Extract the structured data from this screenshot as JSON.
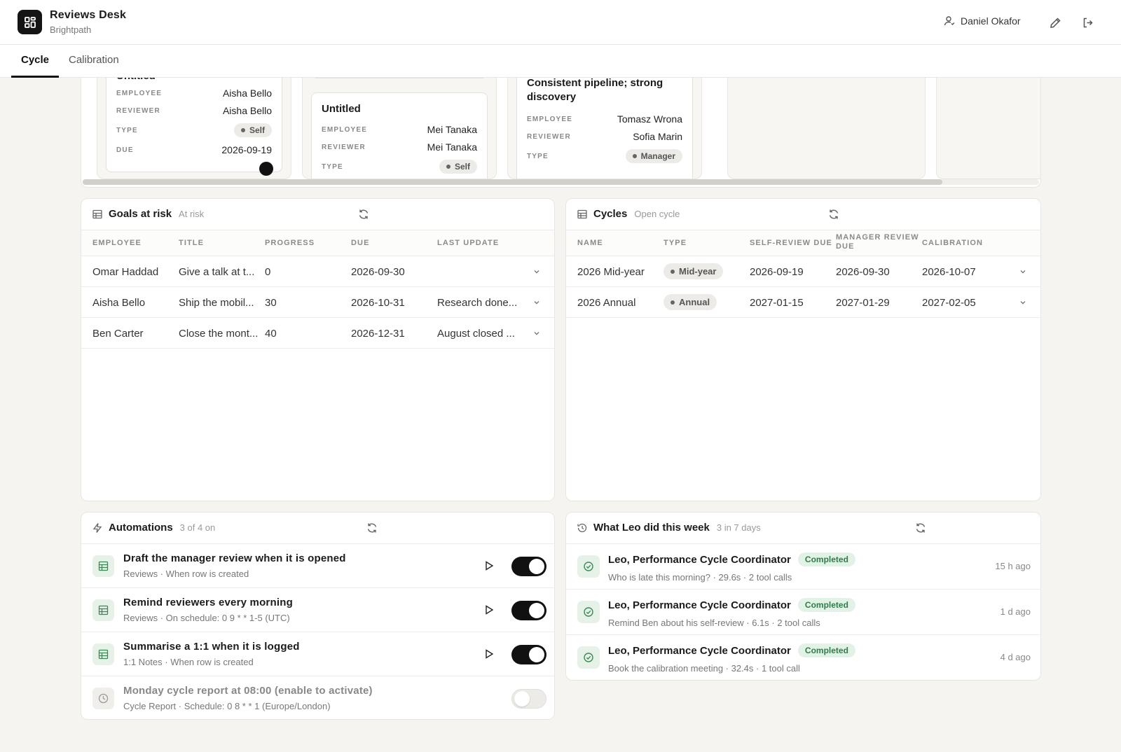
{
  "app": {
    "title": "Reviews Desk",
    "org": "Brightpath",
    "user": "Daniel Okafor"
  },
  "tabs": [
    {
      "label": "Cycle",
      "active": true
    },
    {
      "label": "Calibration",
      "active": false
    }
  ],
  "kanban": {
    "cards": [
      {
        "title": "Untitled",
        "rows": [
          {
            "label": "EMPLOYEE",
            "value": "Aisha Bello"
          },
          {
            "label": "REVIEWER",
            "value": "Aisha Bello"
          },
          {
            "label": "TYPE",
            "value": "Self"
          },
          {
            "label": "DUE",
            "value": "2026-09-19"
          }
        ]
      },
      {
        "title": "Untitled",
        "rows": [
          {
            "label": "EMPLOYEE",
            "value": "Mei Tanaka"
          },
          {
            "label": "REVIEWER",
            "value": "Mei Tanaka"
          },
          {
            "label": "TYPE",
            "value": "Self"
          }
        ]
      },
      {
        "title": "Consistent pipeline; strong discovery",
        "rows": [
          {
            "label": "EMPLOYEE",
            "value": "Tomasz Wrona"
          },
          {
            "label": "REVIEWER",
            "value": "Sofia Marin"
          },
          {
            "label": "TYPE",
            "value": "Manager"
          }
        ]
      }
    ],
    "scroll_position": 0.9
  },
  "goals": {
    "title": "Goals at risk",
    "subtitle": "At risk",
    "columns": [
      "EMPLOYEE",
      "TITLE",
      "PROGRESS",
      "DUE",
      "LAST UPDATE"
    ],
    "rows": [
      {
        "employee": "Omar Haddad",
        "title": "Give a talk at t...",
        "progress": "0",
        "due": "2026-09-30",
        "last_update": ""
      },
      {
        "employee": "Aisha Bello",
        "title": "Ship the mobil...",
        "progress": "30",
        "due": "2026-10-31",
        "last_update": "Research done..."
      },
      {
        "employee": "Ben Carter",
        "title": "Close the mont...",
        "progress": "40",
        "due": "2026-12-31",
        "last_update": "August closed ..."
      }
    ]
  },
  "cycles": {
    "title": "Cycles",
    "subtitle": "Open cycle",
    "columns": [
      "NAME",
      "TYPE",
      "SELF-REVIEW DUE",
      "MANAGER REVIEW DUE",
      "CALIBRATION"
    ],
    "rows": [
      {
        "name": "2026 Mid-year",
        "type": "Mid-year",
        "self_due": "2026-09-19",
        "manager_due": "2026-09-30",
        "calibration": "2026-10-07"
      },
      {
        "name": "2026 Annual",
        "type": "Annual",
        "self_due": "2027-01-15",
        "manager_due": "2027-01-29",
        "calibration": "2027-02-05"
      }
    ]
  },
  "automations": {
    "title": "Automations",
    "subtitle": "3 of 4 on",
    "items": [
      {
        "title": "Draft the manager review when it is opened",
        "meta": "Reviews · When row is created",
        "enabled": true,
        "icon": "table-icon"
      },
      {
        "title": "Remind reviewers every morning",
        "meta": "Reviews · On schedule: 0 9 * * 1-5 (UTC)",
        "enabled": true,
        "icon": "table-icon"
      },
      {
        "title": "Summarise a 1:1 when it is logged",
        "meta": "1:1 Notes · When row is created",
        "enabled": true,
        "icon": "table-icon"
      },
      {
        "title": "Monday cycle report at 08:00 (enable to activate)",
        "meta": "Cycle Report · Schedule: 0 8 * * 1 (Europe/London)",
        "enabled": false,
        "icon": "clock-icon"
      }
    ]
  },
  "activity": {
    "title": "What Leo did this week",
    "subtitle": "3 in 7 days",
    "items": [
      {
        "agent": "Leo, Performance Cycle Coordinator",
        "status": "Completed",
        "meta": "Who is late this morning? · 29.6s · 2 tool calls",
        "time": "15 h ago"
      },
      {
        "agent": "Leo, Performance Cycle Coordinator",
        "status": "Completed",
        "meta": "Remind Ben about his self-review · 6.1s · 2 tool calls",
        "time": "1 d ago"
      },
      {
        "agent": "Leo, Performance Cycle Coordinator",
        "status": "Completed",
        "meta": "Book the calibration meeting · 32.4s · 1 tool call",
        "time": "4 d ago"
      }
    ]
  },
  "colors": {
    "accent": "#111111",
    "success": "#2e7d4a",
    "success_bg": "#e3f2e7",
    "background": "#f5f4f1"
  }
}
